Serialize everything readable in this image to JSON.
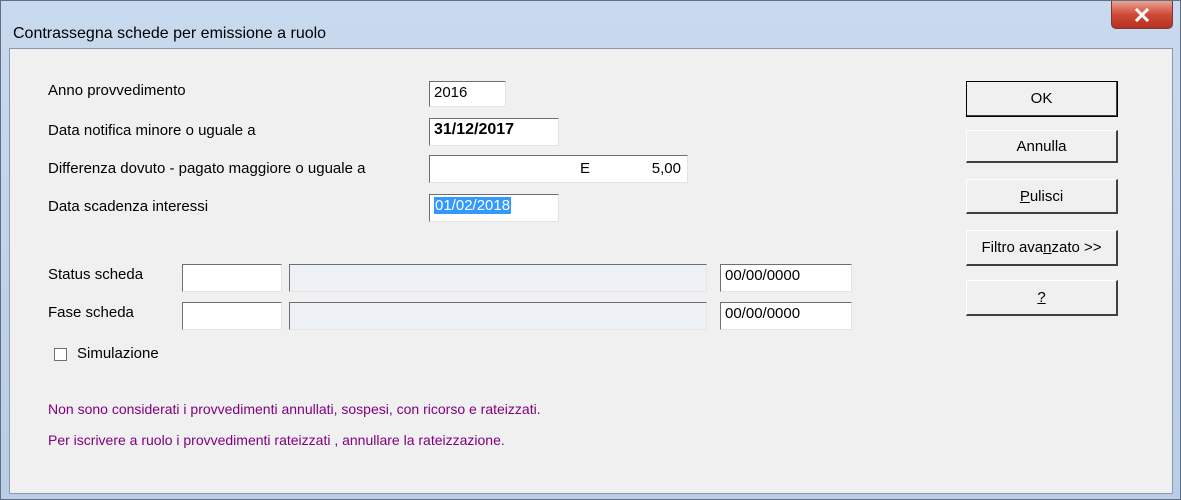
{
  "window": {
    "title": "Contrassegna schede per emissione a ruolo",
    "close_glyph": "X"
  },
  "form": {
    "anno_label": "Anno  provvedimento",
    "anno_value": "2016",
    "data_notifica_label": "Data notifica minore o uguale a",
    "data_notifica_value": "31/12/2017",
    "differenza_label": "Differenza dovuto - pagato maggiore o uguale a",
    "differenza_currency": "E",
    "differenza_value": "5,00",
    "scadenza_label": "Data scadenza interessi",
    "scadenza_value": "01/02/2018",
    "status_label": "Status scheda",
    "status_code": "",
    "status_desc": "",
    "status_date": "00/00/0000",
    "fase_label": "Fase scheda",
    "fase_code": "",
    "fase_desc": "",
    "fase_date": "00/00/0000",
    "simulazione_label": "Simulazione",
    "simulazione_checked": false
  },
  "buttons": {
    "ok": "OK",
    "annulla": "Annulla",
    "pulisci_first": "P",
    "pulisci_rest": "ulisci",
    "filtro_pre": "Filtro ava",
    "filtro_ul": "n",
    "filtro_post": "zato >>",
    "help": "?"
  },
  "notes": {
    "line1": "Non sono considerati i provvedimenti annullati, sospesi, con ricorso e rateizzati.",
    "line2": "Per iscrivere a ruolo i provvedimenti rateizzati , annullare la rateizzazione."
  },
  "colors": {
    "note_text": "#800080",
    "selection": "#3399ff",
    "close_button": "#cf4a37"
  }
}
